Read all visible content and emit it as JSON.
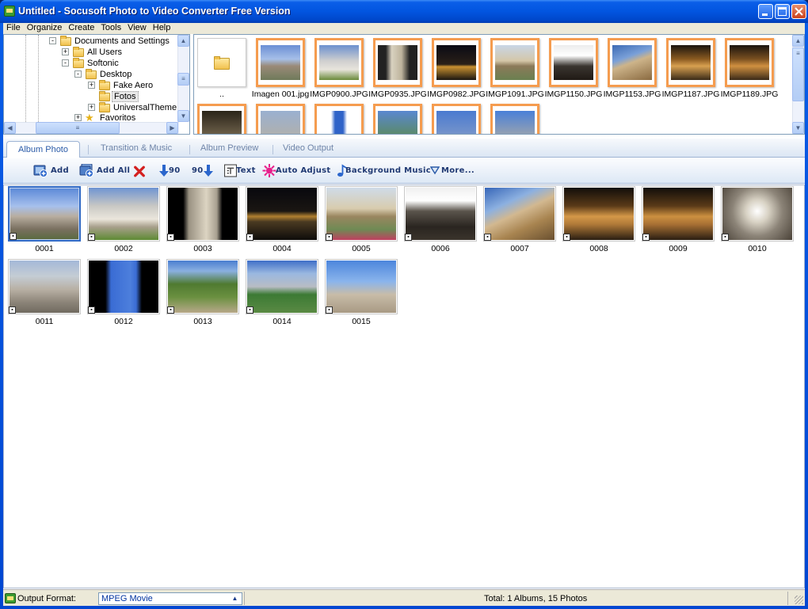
{
  "window": {
    "title": "Untitled - Socusoft Photo to Video Converter Free Version"
  },
  "menu": [
    "File",
    "Organize",
    "Create",
    "Tools",
    "View",
    "Help"
  ],
  "tree": {
    "items": [
      {
        "label": "Documents and Settings",
        "expander": "-"
      },
      {
        "label": "All Users",
        "expander": "+"
      },
      {
        "label": "Softonic",
        "expander": "-"
      },
      {
        "label": "Desktop",
        "expander": "-"
      },
      {
        "label": "Fake Aero",
        "expander": "+"
      },
      {
        "label": "Fotos",
        "expander": ""
      },
      {
        "label": "UniversalThemePat",
        "expander": "+"
      },
      {
        "label": "Favoritos",
        "expander": "+"
      }
    ]
  },
  "browser": {
    "up_label": "..",
    "files": [
      "Imagen 001.jpg",
      "IMGP0900.JPG",
      "IMGP0935.JPG",
      "IMGP0982.JPG",
      "IMGP1091.JPG",
      "IMGP1150.JPG",
      "IMGP1153.JPG",
      "IMGP1187.JPG",
      "IMGP1189.JPG"
    ]
  },
  "tabs": [
    "Album Photo",
    "Transition & Music",
    "Album Preview",
    "Video Output"
  ],
  "toolbar": {
    "add": "Add",
    "add_all": "Add All",
    "rotate_left": "90",
    "rotate_right": "90",
    "text": "Text",
    "auto_adjust": "Auto Adjust",
    "background_music": "Background Music",
    "more": "More..."
  },
  "album": {
    "photos": [
      "0001",
      "0002",
      "0003",
      "0004",
      "0005",
      "0006",
      "0007",
      "0008",
      "0009",
      "0010",
      "0011",
      "0012",
      "0013",
      "0014",
      "0015"
    ]
  },
  "status": {
    "output_label": "Output Format:",
    "format": "MPEG Movie",
    "total": "Total: 1 Albums, 15 Photos"
  },
  "colors": {
    "accent": "#316ac5",
    "thumb_border": "#f59c4f",
    "titlebar": "#0255e0"
  }
}
